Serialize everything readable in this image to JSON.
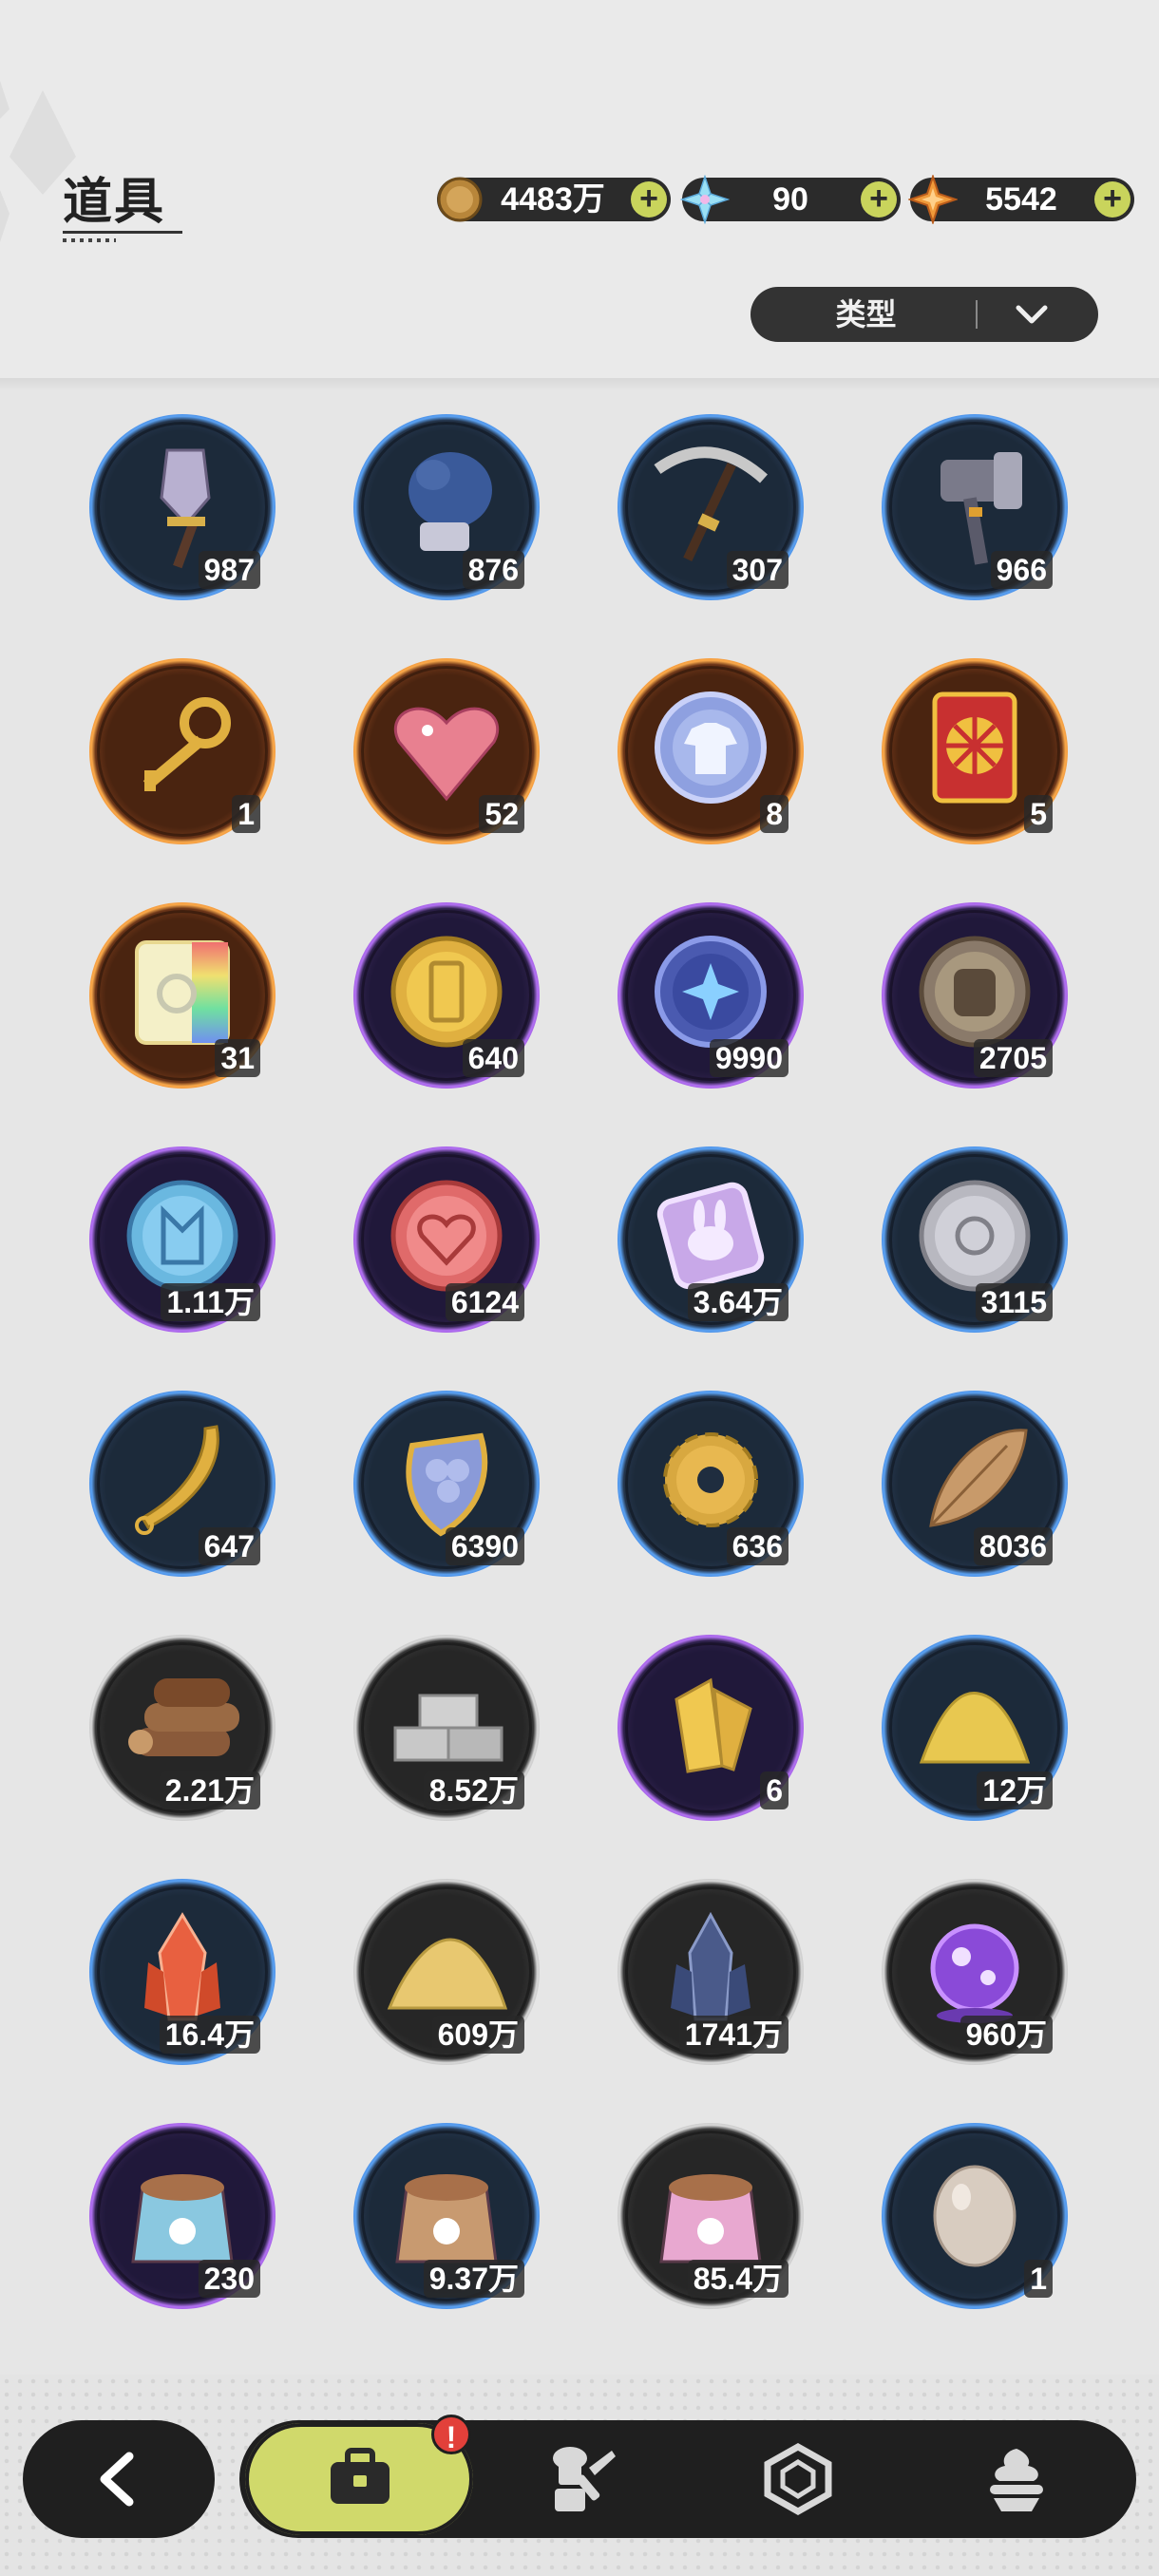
{
  "header": {
    "title": "道具",
    "currencies": [
      {
        "name": "gold-coin",
        "icon": "gold-coin-icon",
        "value": "4483万"
      },
      {
        "name": "crystal",
        "icon": "snowflake-crystal-icon",
        "value": "90"
      },
      {
        "name": "star-shard",
        "icon": "orange-star-icon",
        "value": "5542"
      }
    ],
    "plus_symbol": "+",
    "filter": {
      "label": "类型",
      "icon": "chevron-down-icon"
    }
  },
  "colors": {
    "blue": "#3b7fe0",
    "orange": "#f08a2e",
    "purple": "#9d4fe0",
    "gray": "#b8b8b8",
    "accent": "#d0d96b",
    "alert": "#e2403a"
  },
  "items": [
    {
      "name": "shovel",
      "icon": "shovel-icon",
      "rarity": "blue",
      "qty": "987"
    },
    {
      "name": "glove",
      "icon": "glove-icon",
      "rarity": "blue",
      "qty": "876"
    },
    {
      "name": "pickaxe",
      "icon": "pickaxe-icon",
      "rarity": "blue",
      "qty": "307"
    },
    {
      "name": "hammer",
      "icon": "hammer-icon",
      "rarity": "blue",
      "qty": "966"
    },
    {
      "name": "golden-key",
      "icon": "key-icon",
      "rarity": "orange",
      "qty": "1"
    },
    {
      "name": "crystal-heart",
      "icon": "crystal-heart-icon",
      "rarity": "orange",
      "qty": "52"
    },
    {
      "name": "outfit-token",
      "icon": "shirt-token-icon",
      "rarity": "orange",
      "qty": "8"
    },
    {
      "name": "wheel-ticket",
      "icon": "wheel-ticket-icon",
      "rarity": "orange",
      "qty": "5"
    },
    {
      "name": "rainbow-ticket",
      "icon": "rainbow-ticket-icon",
      "rarity": "orange",
      "qty": "31"
    },
    {
      "name": "gold-coin-item",
      "icon": "gold-coin-icon",
      "rarity": "purple",
      "qty": "640"
    },
    {
      "name": "star-coin",
      "icon": "star-coin-icon",
      "rarity": "purple",
      "qty": "9990"
    },
    {
      "name": "fist-coin",
      "icon": "fist-coin-icon",
      "rarity": "purple",
      "qty": "2705"
    },
    {
      "name": "blue-emblem-coin",
      "icon": "emblem-coin-icon",
      "rarity": "purple",
      "qty": "1.11万"
    },
    {
      "name": "heart-coin",
      "icon": "heart-coin-icon",
      "rarity": "purple",
      "qty": "6124"
    },
    {
      "name": "bunny-card",
      "icon": "bunny-card-icon",
      "rarity": "blue",
      "qty": "3.64万"
    },
    {
      "name": "silver-coin",
      "icon": "silver-coin-icon",
      "rarity": "blue",
      "qty": "3115"
    },
    {
      "name": "golden-blade",
      "icon": "blade-icon",
      "rarity": "blue",
      "qty": "647"
    },
    {
      "name": "scale-shield",
      "icon": "scale-shield-icon",
      "rarity": "blue",
      "qty": "6390"
    },
    {
      "name": "gear",
      "icon": "gear-icon",
      "rarity": "blue",
      "qty": "636"
    },
    {
      "name": "golden-leaf",
      "icon": "leaf-icon",
      "rarity": "blue",
      "qty": "8036"
    },
    {
      "name": "wood-logs",
      "icon": "logs-icon",
      "rarity": "gray",
      "qty": "2.21万"
    },
    {
      "name": "stone-bricks",
      "icon": "bricks-icon",
      "rarity": "gray",
      "qty": "8.52万"
    },
    {
      "name": "gold-shards",
      "icon": "gold-shards-icon",
      "rarity": "purple",
      "qty": "6"
    },
    {
      "name": "gold-dust",
      "icon": "gold-dust-icon",
      "rarity": "blue",
      "qty": "12万"
    },
    {
      "name": "red-crystal",
      "icon": "red-crystal-icon",
      "rarity": "blue",
      "qty": "16.4万"
    },
    {
      "name": "sand-pile",
      "icon": "sand-pile-icon",
      "rarity": "gray",
      "qty": "609万"
    },
    {
      "name": "dark-crystal",
      "icon": "dark-crystal-icon",
      "rarity": "gray",
      "qty": "1741万"
    },
    {
      "name": "purple-orb",
      "icon": "purple-orb-icon",
      "rarity": "gray",
      "qty": "960万"
    },
    {
      "name": "pink-food-bag",
      "icon": "pet-food-bag-icon",
      "rarity": "purple",
      "qty": "230"
    },
    {
      "name": "blue-food-bag",
      "icon": "pet-food-bag-icon",
      "rarity": "blue",
      "qty": "9.37万"
    },
    {
      "name": "brown-food-bag",
      "icon": "pet-food-bag-icon",
      "rarity": "gray",
      "qty": "85.4万"
    },
    {
      "name": "egg",
      "icon": "egg-icon",
      "rarity": "blue",
      "qty": "1"
    }
  ],
  "nav": {
    "back": "back-arrow-icon",
    "tabs": [
      {
        "name": "bag",
        "icon": "bag-icon",
        "active": true,
        "badge": "!"
      },
      {
        "name": "chef",
        "icon": "chef-knife-icon",
        "active": false
      },
      {
        "name": "gem",
        "icon": "hexagon-gem-icon",
        "active": false
      },
      {
        "name": "dessert",
        "icon": "dessert-icon",
        "active": false
      }
    ]
  }
}
